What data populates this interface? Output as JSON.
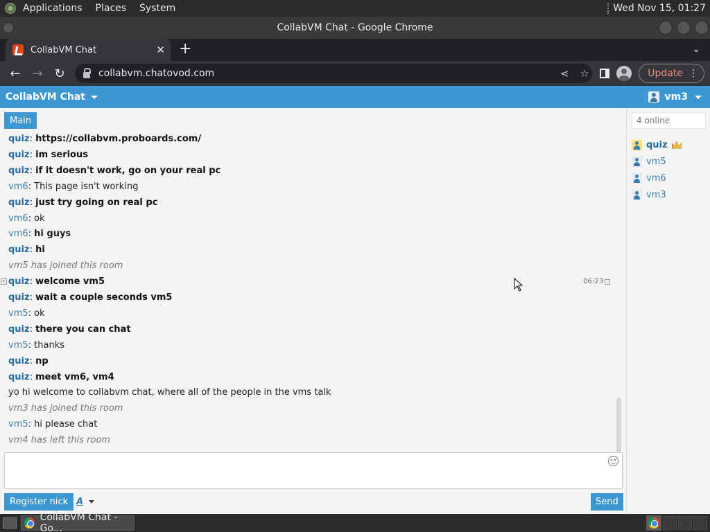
{
  "desktop": {
    "menus": [
      "Applications",
      "Places",
      "System"
    ],
    "clock": "Wed Nov 15, 01:27"
  },
  "window": {
    "title": "CollabVM Chat - Google Chrome"
  },
  "browser": {
    "tab_title": "CollabVM Chat",
    "url": "collabvm.chatovod.com",
    "update_label": "Update"
  },
  "chat": {
    "app_title": "CollabVM Chat",
    "current_user": "vm3",
    "room_tab": "Main",
    "messages": [
      {
        "nick": "quiz",
        "text": "https://collabvm.proboards.com/",
        "style": "link"
      },
      {
        "nick": "quiz",
        "text": "im serious",
        "style": "bold"
      },
      {
        "nick": "quiz",
        "text": "if it doesn't work, go on your real pc",
        "style": "bold"
      },
      {
        "nick": "vm6",
        "text": "This page isn't working",
        "style": "normal"
      },
      {
        "nick": "quiz",
        "text": "just try going on real pc",
        "style": "bold"
      },
      {
        "nick": "vm6",
        "text": "ok",
        "style": "normal"
      },
      {
        "nick": "vm6",
        "text": "hi guys",
        "style": "bold-text"
      },
      {
        "nick": "quiz",
        "text": "hi",
        "style": "bold"
      },
      {
        "nick": "",
        "text": "vm5 has joined this room",
        "style": "system"
      },
      {
        "nick": "quiz",
        "text": "welcome vm5",
        "style": "bold"
      },
      {
        "nick": "quiz",
        "text": "wait a couple seconds vm5",
        "style": "bold"
      },
      {
        "nick": "vm5",
        "text": "ok",
        "style": "normal"
      },
      {
        "nick": "quiz",
        "text": "there you can chat",
        "style": "bold"
      },
      {
        "nick": "vm5",
        "text": "thanks",
        "style": "normal"
      },
      {
        "nick": "quiz",
        "text": "np",
        "style": "bold"
      },
      {
        "nick": "quiz",
        "text": "meet vm6, vm4",
        "style": "bold"
      },
      {
        "nick": "",
        "text": "yo hi welcome to collabvm chat, where all of the people in the vms talk",
        "style": "plain"
      },
      {
        "nick": "",
        "text": "vm3 has joined this room",
        "style": "system"
      },
      {
        "nick": "vm5",
        "text": "hi please chat",
        "style": "normal"
      },
      {
        "nick": "",
        "text": "vm4 has left this room",
        "style": "system"
      }
    ],
    "hover_time": "06:23",
    "register_label": "Register nick",
    "font_label": "A",
    "send_label": "Send",
    "online_label": "4 online",
    "users": [
      {
        "name": "quiz",
        "owner": true
      },
      {
        "name": "vm5",
        "owner": false
      },
      {
        "name": "vm6",
        "owner": false
      },
      {
        "name": "vm3",
        "owner": false
      }
    ]
  },
  "taskbar": {
    "task_label": "CollabVM Chat - Go..."
  },
  "colors": {
    "accent": "#3d98d1",
    "nick": "#3a7fb0",
    "panel": "#2b2b2b"
  }
}
